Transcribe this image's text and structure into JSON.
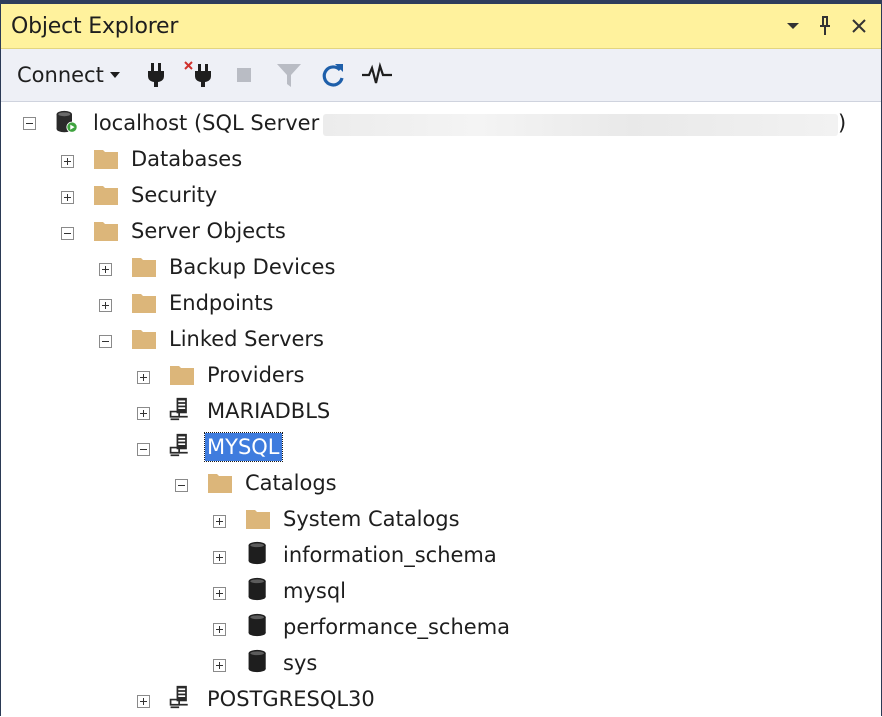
{
  "window": {
    "title": "Object Explorer",
    "title_bg": "#fff29d",
    "controls": [
      "dropdown-icon",
      "pin-icon",
      "close-icon"
    ]
  },
  "toolbar": {
    "connect_label": "Connect",
    "buttons": [
      "connect-object-icon",
      "disconnect-icon",
      "stop-icon",
      "filter-icon",
      "refresh-icon",
      "activity-monitor-icon"
    ]
  },
  "tree": {
    "root": {
      "label_prefix": "localhost (SQL Server",
      "label_suffix": ")"
    },
    "databases": "Databases",
    "security": "Security",
    "server_objects": "Server Objects",
    "backup_devices": "Backup Devices",
    "endpoints": "Endpoints",
    "linked_servers": "Linked Servers",
    "providers": "Providers",
    "mariadbls": "MARIADBLS",
    "mysql": "MYSQL",
    "catalogs": "Catalogs",
    "system_catalogs": "System Catalogs",
    "information_schema": "information_schema",
    "mysql_db": "mysql",
    "performance_schema": "performance_schema",
    "sys": "sys",
    "postgresql30": "POSTGRESQL30"
  },
  "colors": {
    "selection": "#3f7cde",
    "folder": "#dcb67a",
    "database": "#1e1e1e",
    "connected_badge": "#3fa33f"
  }
}
